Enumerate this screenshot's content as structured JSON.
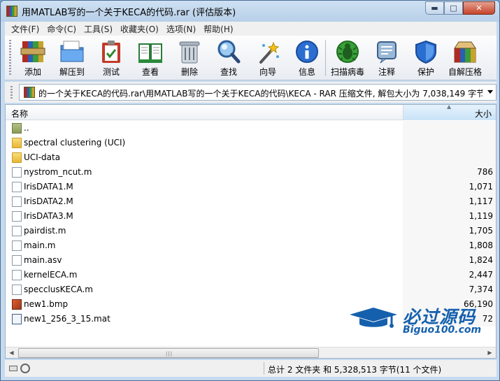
{
  "window": {
    "title": "用MATLAB写的一个关于KECA的代码.rar (评估版本)"
  },
  "titlebar_buttons": {
    "minimize": "▬",
    "maximize": "□",
    "close": "✕"
  },
  "menu": [
    "文件(F)",
    "命令(C)",
    "工具(S)",
    "收藏夹(O)",
    "选项(N)",
    "帮助(H)"
  ],
  "toolbar": [
    {
      "label": "添加",
      "icon": "add-archive-icon"
    },
    {
      "label": "解压到",
      "icon": "extract-folder-icon"
    },
    {
      "label": "测试",
      "icon": "test-clipboard-icon"
    },
    {
      "label": "查看",
      "icon": "view-book-icon"
    },
    {
      "label": "删除",
      "icon": "trash-icon"
    },
    {
      "label": "查找",
      "icon": "magnifier-icon"
    },
    {
      "label": "向导",
      "icon": "wizard-wand-icon"
    },
    {
      "label": "信息",
      "icon": "info-icon"
    },
    {
      "label": "扫描病毒",
      "icon": "virus-bug-icon"
    },
    {
      "label": "注释",
      "icon": "comment-note-icon"
    },
    {
      "label": "保护",
      "icon": "shield-icon"
    },
    {
      "label": "自解压格",
      "icon": "sfx-box-icon"
    }
  ],
  "address": {
    "path": "的一个关于KECA的代码.rar\\用MATLAB写的一个关于KECA的代码\\KECA - RAR 压缩文件, 解包大小为 7,038,149 字节"
  },
  "columns": {
    "name": "名称",
    "size": "大小"
  },
  "files": [
    {
      "name": "..",
      "size": "",
      "type": "up"
    },
    {
      "name": "spectral clustering (UCI)",
      "size": "",
      "type": "folder"
    },
    {
      "name": "UCI-data",
      "size": "",
      "type": "folder"
    },
    {
      "name": "nystrom_ncut.m",
      "size": "786",
      "type": "doc"
    },
    {
      "name": "IrisDATA1.M",
      "size": "1,071",
      "type": "doc"
    },
    {
      "name": "IrisDATA2.M",
      "size": "1,117",
      "type": "doc"
    },
    {
      "name": "IrisDATA3.M",
      "size": "1,119",
      "type": "doc"
    },
    {
      "name": "pairdist.m",
      "size": "1,705",
      "type": "doc"
    },
    {
      "name": "main.m",
      "size": "1,808",
      "type": "doc"
    },
    {
      "name": "main.asv",
      "size": "1,824",
      "type": "doc"
    },
    {
      "name": "kernelECA.m",
      "size": "2,447",
      "type": "doc"
    },
    {
      "name": "specclusKECA.m",
      "size": "7,374",
      "type": "doc"
    },
    {
      "name": "new1.bmp",
      "size": "66,190",
      "type": "bmp"
    },
    {
      "name": "new1_256_3_15.mat",
      "size": "72",
      "type": "mat"
    }
  ],
  "status": {
    "summary": "总计 2 文件夹 和 5,328,513 字节(11 个文件)"
  },
  "watermark": {
    "title": "必过源码",
    "url": "Biguo100.com"
  }
}
